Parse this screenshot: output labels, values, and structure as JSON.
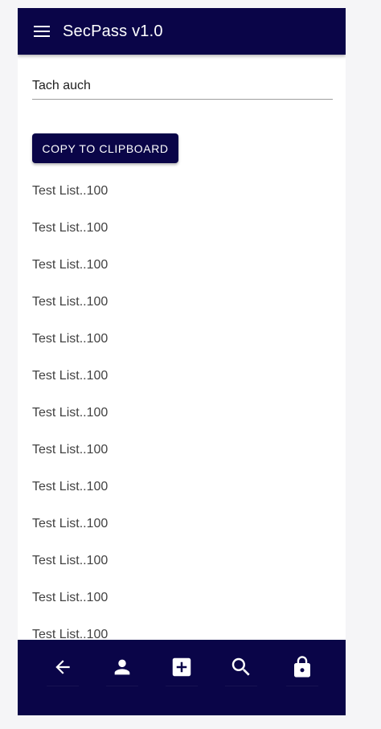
{
  "app": {
    "title": "SecPass v1.0"
  },
  "entry": {
    "value": "Tach auch"
  },
  "copy_button": {
    "label": "COPY TO CLIPBOARD"
  },
  "list": {
    "items": [
      "Test List..100",
      "Test List..100",
      "Test List..100",
      "Test List..100",
      "Test List..100",
      "Test List..100",
      "Test List..100",
      "Test List..100",
      "Test List..100",
      "Test List..100",
      "Test List..100",
      "Test List..100",
      "Test List..100"
    ]
  },
  "bottom_nav": {
    "icons": [
      "back-arrow-icon",
      "person-icon",
      "add-box-icon",
      "search-icon",
      "lock-icon"
    ]
  },
  "colors": {
    "primary": "#0a0548",
    "background": "#ffffff",
    "text": "#424242"
  }
}
